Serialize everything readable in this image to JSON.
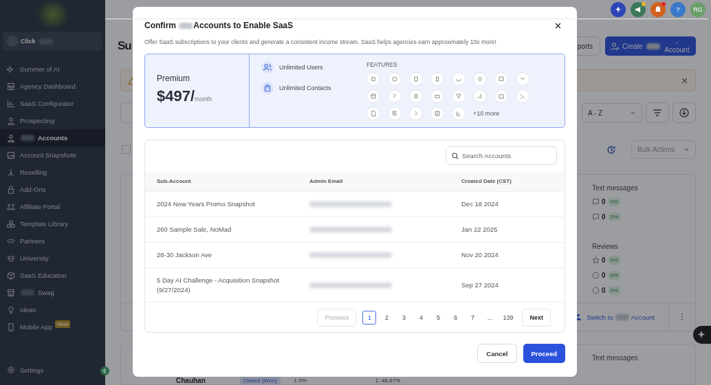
{
  "sidebar": {
    "switcher": "Click",
    "items": [
      {
        "label": "Summer of AI",
        "blurred_prefix": false,
        "selected": false
      },
      {
        "label": "Agency Dashboard",
        "blurred_prefix": false,
        "selected": false
      },
      {
        "label": "SaaS Configurator",
        "blurred_prefix": false,
        "selected": false
      },
      {
        "label": "Prospecting",
        "blurred_prefix": false,
        "selected": false
      },
      {
        "label": "Accounts",
        "blurred_prefix": true,
        "selected": true
      },
      {
        "label": "Account Snapshots",
        "blurred_prefix": false,
        "selected": false
      },
      {
        "label": "Reselling",
        "blurred_prefix": false,
        "selected": false
      },
      {
        "label": "Add-Ons",
        "blurred_prefix": false,
        "selected": false
      },
      {
        "label": "Affiliate Portal",
        "blurred_prefix": false,
        "selected": false
      },
      {
        "label": "Template Library",
        "blurred_prefix": false,
        "selected": false
      },
      {
        "label": "Partners",
        "blurred_prefix": false,
        "selected": false
      },
      {
        "label": "University",
        "blurred_prefix": false,
        "selected": false
      },
      {
        "label": "SaaS Education",
        "blurred_prefix": false,
        "selected": false
      },
      {
        "label": "Swag",
        "blurred_prefix": true,
        "selected": false
      },
      {
        "label": "Ideas",
        "blurred_prefix": false,
        "selected": false
      },
      {
        "label": "Mobile App",
        "blurred_prefix": false,
        "selected": false,
        "badge": "New"
      }
    ],
    "settings": "Settings"
  },
  "header": {
    "buttons": [
      {
        "kind": "sparkle",
        "color": "#2c46b8",
        "notification": false
      },
      {
        "kind": "megaphone",
        "color": "#3a7a5a",
        "notification": true
      },
      {
        "kind": "bell",
        "color": "#d0621e",
        "notification": true
      },
      {
        "kind": "text",
        "text": "?",
        "color": "#3a78c8",
        "notification": false
      },
      {
        "kind": "text",
        "text": "RG",
        "color": "#6a9f6a",
        "notification": false
      }
    ]
  },
  "page": {
    "title": "Su",
    "reports_button": "ports",
    "create_button": {
      "before": "Create",
      "after": "-Account"
    },
    "sort": "A - Z",
    "bulk_actions": "Bulk Actions",
    "select_all_checked": false,
    "card": {
      "groups": [
        {
          "title": "Text messages",
          "rows": [
            {
              "value": "0",
              "change": "0%"
            },
            {
              "value": "0",
              "change": "0%"
            }
          ]
        },
        {
          "title": "Reviews",
          "rows": [
            {
              "value": "0",
              "change": "0%"
            },
            {
              "value": "0",
              "change": "0%"
            },
            {
              "value": "0",
              "change": "0%"
            }
          ]
        }
      ],
      "switch_link": {
        "before": "Switch to",
        "after": "Account"
      }
    },
    "card2": {
      "title": "Text messages",
      "name": "Chauhan",
      "status": "Closed (Won)",
      "stats": [
        {
          "value": "1",
          "change": "0%"
        },
        {
          "value": "1",
          "change": "-46.67%"
        }
      ]
    }
  },
  "modal": {
    "title": {
      "before": "Confirm",
      "after": "Accounts to Enable SaaS"
    },
    "subtitle": "Offer SaaS subscriptions to your clients and generate a consistent income stream. SaaS helps agencies earn approximately 10x more!",
    "plan": {
      "name": "Premium",
      "price": "$497/",
      "period": "month"
    },
    "perks": [
      "Unlimited Users",
      "Unlimited Contacts"
    ],
    "features_label": "FEATURES",
    "more": "+10 more",
    "search": {
      "placeholder": "Search Accounts"
    },
    "table": {
      "columns": [
        "Sub-Account",
        "Admin Email",
        "Created Date (CST)"
      ],
      "rows": [
        {
          "name": "2024 New Years Promo Snapshot",
          "date": "Dec 18 2024"
        },
        {
          "name": "260 Sample Sale, NoMad",
          "date": "Jan 22 2025"
        },
        {
          "name": "28-30 Jackson Ave",
          "date": "Nov 20 2024"
        },
        {
          "name": "5 Day AI Challenge - Acquisition Snapshot (9/27/2024)",
          "date": "Sep 27 2024"
        }
      ]
    },
    "pagination": {
      "previous": "Previous",
      "previous_disabled": true,
      "next": "Next",
      "pages": [
        {
          "label": "1",
          "selected": true
        },
        {
          "label": "2",
          "selected": false
        },
        {
          "label": "3",
          "selected": false
        },
        {
          "label": "4",
          "selected": false
        },
        {
          "label": "5",
          "selected": false
        },
        {
          "label": "6",
          "selected": false
        },
        {
          "label": "7",
          "selected": false
        },
        {
          "label": "...",
          "selected": false
        },
        {
          "label": "139",
          "selected": false
        }
      ]
    },
    "buttons": {
      "cancel": "Cancel",
      "proceed": "Proceed"
    }
  }
}
